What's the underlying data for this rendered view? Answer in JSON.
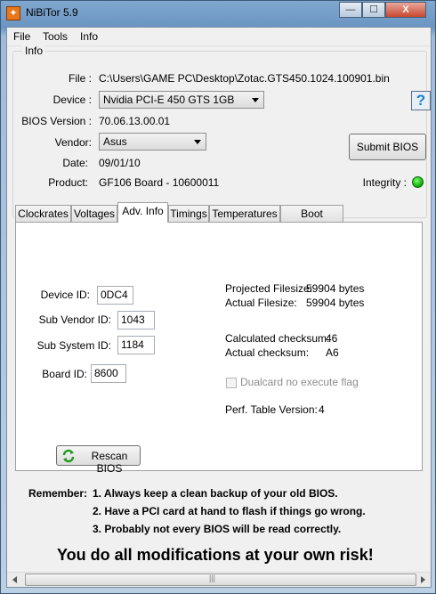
{
  "window": {
    "title": "NiBiTor 5.9",
    "app_icon": "nibitor-logo-icon",
    "minimize_glyph": "—",
    "maximize_glyph": "☐",
    "close_glyph": "X"
  },
  "menu": {
    "items": [
      "File",
      "Tools",
      "Info"
    ]
  },
  "info": {
    "group_title": "Info",
    "file_label": "File :",
    "file_value": "C:\\Users\\GAME PC\\Desktop\\Zotac.GTS450.1024.100901.bin",
    "device_label": "Device :",
    "device_value": "Nvidia PCI-E 450 GTS 1GB",
    "bios_version_label": "BIOS Version :",
    "bios_version_value": "70.06.13.00.01",
    "vendor_label": "Vendor:",
    "vendor_value": "Asus",
    "date_label": "Date:",
    "date_value": "09/01/10",
    "product_label": "Product:",
    "product_value": "GF106 Board - 10600011",
    "submit_button": "Submit BIOS",
    "help_glyph": "?",
    "integrity_label": "Integrity :",
    "integrity_color": "#19b319"
  },
  "tabs": [
    "Clockrates",
    "Voltages",
    "Adv. Info",
    "Timings",
    "Temperatures",
    "Boot Settings"
  ],
  "active_tab": "Adv. Info",
  "adv_info": {
    "device_id_label": "Device ID:",
    "device_id": "0DC4",
    "sub_vendor_id_label": "Sub Vendor ID:",
    "sub_vendor_id": "1043",
    "sub_system_id_label": "Sub System ID:",
    "sub_system_id": "1184",
    "board_id_label": "Board ID:",
    "board_id": "8600",
    "projected_filesize_label": "Projected Filesize:",
    "projected_filesize": "59904 bytes",
    "actual_filesize_label": "Actual Filesize:",
    "actual_filesize": "59904 bytes",
    "calculated_checksum_label": "Calculated checksum:",
    "calculated_checksum": "46",
    "actual_checksum_label": "Actual checksum:",
    "actual_checksum": "A6",
    "dualcard_label": "Dualcard no execute flag",
    "perf_table_label": "Perf. Table Version:",
    "perf_table_version": "4",
    "rescan_button": "Rescan BIOS"
  },
  "warnings": {
    "remember_label": "Remember:",
    "line1": "1. Always keep a clean backup of your old BIOS.",
    "line2": "2. Have a PCI card at hand to flash if things go wrong.",
    "line3": "3. Probably not every BIOS will be read correctly.",
    "risk": "You do all modifications at your own risk!"
  },
  "scrollbar": {
    "grip": "|||"
  }
}
